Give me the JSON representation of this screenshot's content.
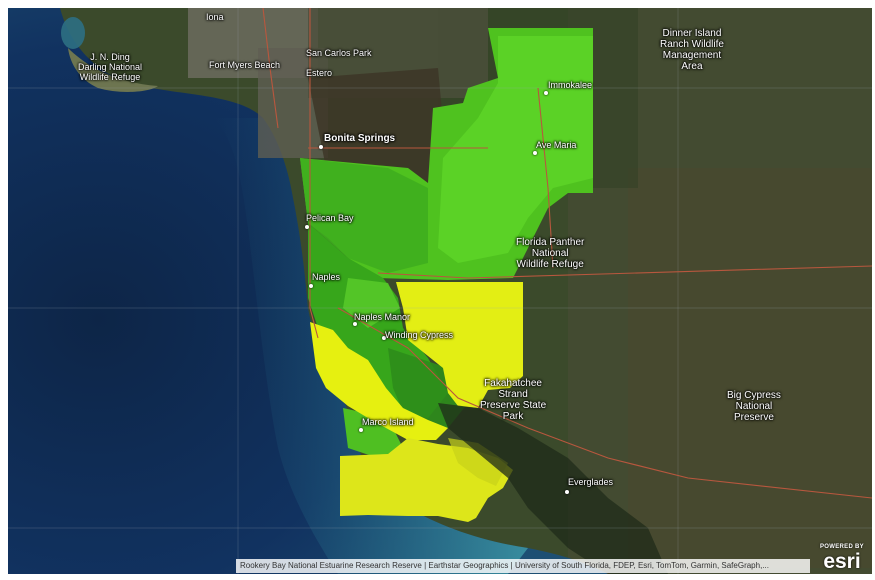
{
  "map": {
    "labels": {
      "jn_ding": "J. N. Ding\nDarling National\nWildlife Refuge",
      "iona": "Iona",
      "fort_myers_beach": "Fort Myers Beach",
      "san_carlos_park": "San Carlos Park",
      "estero": "Estero",
      "bonita_springs": "Bonita Springs",
      "dinner_island": "Dinner Island\nRanch Wildlife\nManagement\nArea",
      "immokalee": "Immokalee",
      "ave_maria": "Ave Maria",
      "pelican_bay": "Pelican Bay",
      "florida_panther": "Florida Panther\nNational\nWildlife Refuge",
      "naples": "Naples",
      "naples_manor": "Naples Manor",
      "winding_cypress": "Winding Cypress",
      "fakahatchee": "Fakahatchee\nStrand\nPreserve State\nPark",
      "big_cypress": "Big Cypress\nNational\nPreserve",
      "marco_island": "Marco Island",
      "everglades": "Everglades"
    },
    "colors": {
      "water_deep": "#0e2b52",
      "water_shallow": "#2f7d92",
      "land": "#3a4a2a",
      "urban": "#6b6a5d",
      "green_bright": "#5fd122",
      "green_mid": "#3fb122",
      "green_dark": "#2f8f1c",
      "yellow_bright": "#e6f00f",
      "yellow_mid": "#d8e21a",
      "road": "#b4553e"
    },
    "attribution": "Rookery Bay National Estuarine Research Reserve | Earthstar Geographics | University of South Florida, FDEP, Esri, TomTom, Garmin, SafeGraph,...",
    "logo": {
      "powered": "POWERED BY",
      "word": "esri"
    }
  }
}
